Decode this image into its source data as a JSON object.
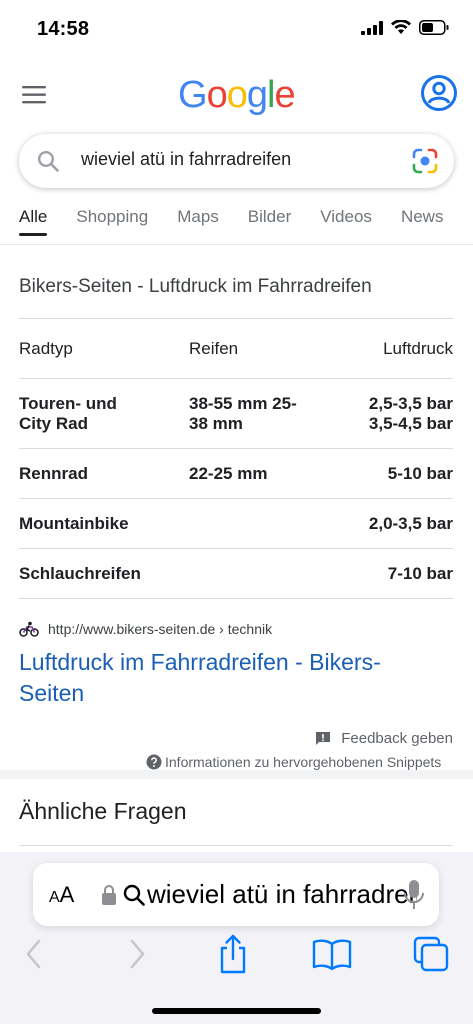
{
  "status_bar": {
    "time": "14:58"
  },
  "header": {
    "logo_letters": [
      "G",
      "o",
      "o",
      "g",
      "l",
      "e"
    ],
    "logo_colors": [
      "#4285F4",
      "#EA4335",
      "#FBBC05",
      "#4285F4",
      "#34A853",
      "#EA4335"
    ]
  },
  "search": {
    "query": "wieviel atü in fahrradreifen"
  },
  "tabs": [
    {
      "label": "Alle",
      "active": true
    },
    {
      "label": "Shopping"
    },
    {
      "label": "Maps"
    },
    {
      "label": "Bilder"
    },
    {
      "label": "Videos"
    },
    {
      "label": "News"
    }
  ],
  "snippet": {
    "title": "Bikers-Seiten - Luftdruck im Fahrradreifen",
    "table": {
      "headers": [
        "Radtyp",
        "Reifen",
        "Luftdruck"
      ],
      "rows": [
        {
          "c1": [
            "Touren- und",
            "City Rad"
          ],
          "c2": [
            "38-55 mm 25-",
            "38 mm"
          ],
          "c3": [
            "2,5-3,5 bar",
            "3,5-4,5 bar"
          ]
        },
        {
          "c1": [
            "Rennrad"
          ],
          "c2": [
            "22-25 mm"
          ],
          "c3": [
            "5-10 bar"
          ]
        },
        {
          "c1": [
            "Mountainbike"
          ],
          "c2": [
            ""
          ],
          "c3": [
            "2,0-3,5 bar"
          ]
        },
        {
          "c1": [
            "Schlauchreifen"
          ],
          "c2": [
            ""
          ],
          "c3": [
            "7-10 bar"
          ]
        }
      ]
    },
    "source_url": "http://www.bikers-seiten.de",
    "source_path": " › technik",
    "link_text": "Luftdruck im Fahrradreifen - Bikers-Seiten",
    "feedback": "Feedback geben",
    "info": "Informationen zu hervorgehobenen Snippets"
  },
  "related": {
    "title": "Ähnliche Fragen"
  },
  "safari": {
    "aa_small": "A",
    "aa_large": "A",
    "address_text": "wieviel atü in fahrradreifen"
  },
  "colors": {
    "link": "#1a5fb4",
    "accent_blue": "#1a73e8",
    "ios_blue": "#007aff"
  }
}
